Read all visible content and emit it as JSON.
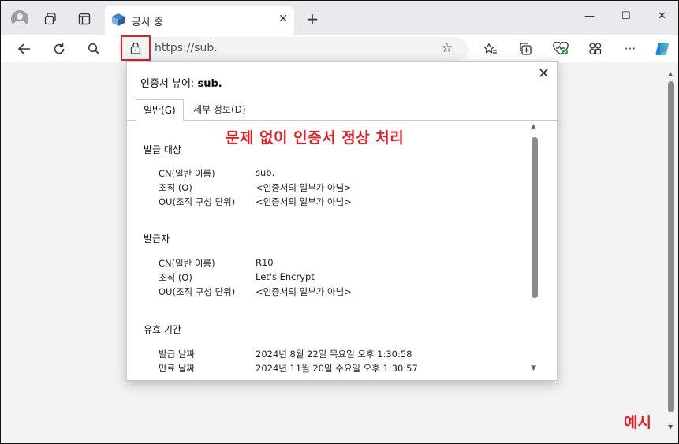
{
  "browser": {
    "tab_title": "공사 중",
    "url": "https://sub.",
    "icons": [
      "profile-icon",
      "workspaces-icon",
      "tab-actions-icon",
      "close-icon",
      "new-tab-icon",
      "minimize-icon",
      "maximize-icon",
      "window-close-icon",
      "back-icon",
      "refresh-icon",
      "search-icon",
      "lock-icon",
      "favorite-icon",
      "favorites-icon",
      "collections-icon",
      "browser-essentials-icon",
      "extensions-icon",
      "more-icon",
      "copilot-icon"
    ]
  },
  "dialog": {
    "title_prefix": "인증서 뷰어: ",
    "title_host": "sub.",
    "tabs": [
      "일반(G)",
      "세부 정보(D)"
    ],
    "note": "문제 없이 인증서 정상 처리",
    "issued_to": {
      "title": "발급 대상",
      "rows": [
        {
          "label": "CN(일반 이름)",
          "value": "sub."
        },
        {
          "label": "조직 (O)",
          "value": "<인증서의 일부가 아님>"
        },
        {
          "label": "OU(조직 구성 단위)",
          "value": "<인증서의 일부가 아님>"
        }
      ]
    },
    "issued_by": {
      "title": "발급자",
      "rows": [
        {
          "label": "CN(일반 이름)",
          "value": "R10"
        },
        {
          "label": "조직 (O)",
          "value": "Let's Encrypt"
        },
        {
          "label": "OU(조직 구성 단위)",
          "value": "<인증서의 일부가 아님>"
        }
      ]
    },
    "validity": {
      "title": "유효 기간",
      "rows": [
        {
          "label": "발급 날짜",
          "value": "2024년 8월 22일 목요일 오후 1:30:58"
        },
        {
          "label": "만료 날짜",
          "value": "2024년 11월 20일 수요일 오후 1:30:57"
        }
      ]
    }
  },
  "annotation": {
    "example_label": "예시",
    "highlight_color": "#e0202a"
  }
}
